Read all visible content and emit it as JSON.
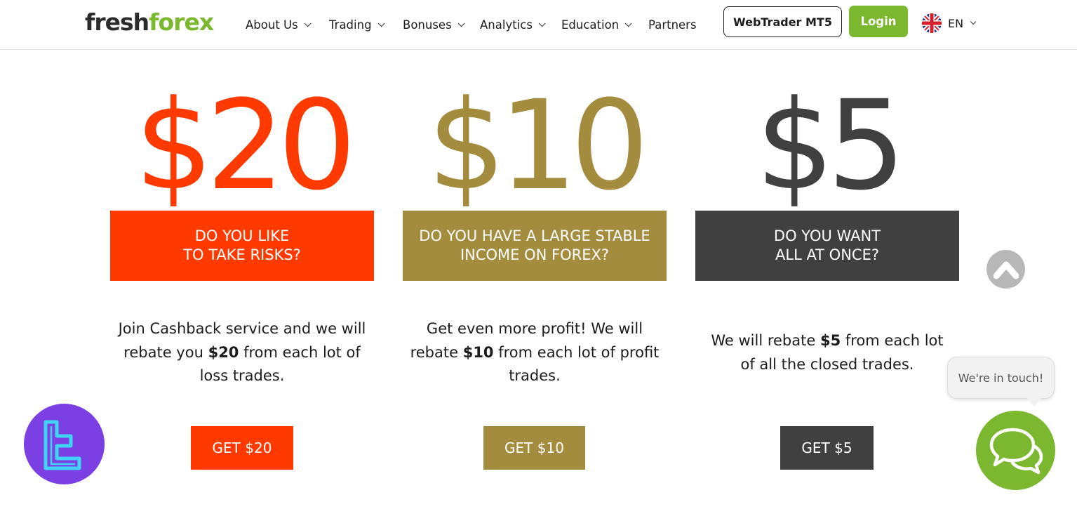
{
  "header": {
    "logo_part1": "fresh",
    "logo_part2": "forex",
    "nav": [
      {
        "label": "About Us",
        "dropdown": true
      },
      {
        "label": "Trading",
        "dropdown": true
      },
      {
        "label": "Bonuses",
        "dropdown": true
      },
      {
        "label": "Analytics",
        "dropdown": true
      },
      {
        "label": "Education",
        "dropdown": true
      },
      {
        "label": "Partners",
        "dropdown": false
      }
    ],
    "webtrader_label": "WebTrader MT5",
    "login_label": "Login",
    "language": "EN",
    "language_icon": "uk-flag-icon"
  },
  "offers": [
    {
      "amount": "$20",
      "color": "#ff3a00",
      "box_line1": "DO YOU LIKE",
      "box_line2": "TO TAKE RISKS?",
      "desc_pre": "Join Cashback service and we will rebate you ",
      "desc_bold": "$20",
      "desc_post": " from each lot of loss trades.",
      "button": "GET $20"
    },
    {
      "amount": "$10",
      "color": "#a48c3e",
      "box_line1": "DO YOU HAVE A LARGE STABLE",
      "box_line2": "INCOME ON FOREX?",
      "desc_pre": "Get even more profit! We will rebate ",
      "desc_bold": "$10",
      "desc_post": " from each lot of profit trades.",
      "button": "GET $10"
    },
    {
      "amount": "$5",
      "color": "#404040",
      "box_line1": "DO YOU WANT",
      "box_line2": "ALL AT ONCE?",
      "desc_pre": "We will rebate ",
      "desc_bold": "$5",
      "desc_post": " from each lot of all the closed trades.",
      "button": "GET $5"
    }
  ],
  "widgets": {
    "chat_bubble": "We're in touch!",
    "chat_icon": "chat-bubbles-icon",
    "scroll_icon": "scroll-top-icon",
    "brand_color": "#7cb82f"
  }
}
